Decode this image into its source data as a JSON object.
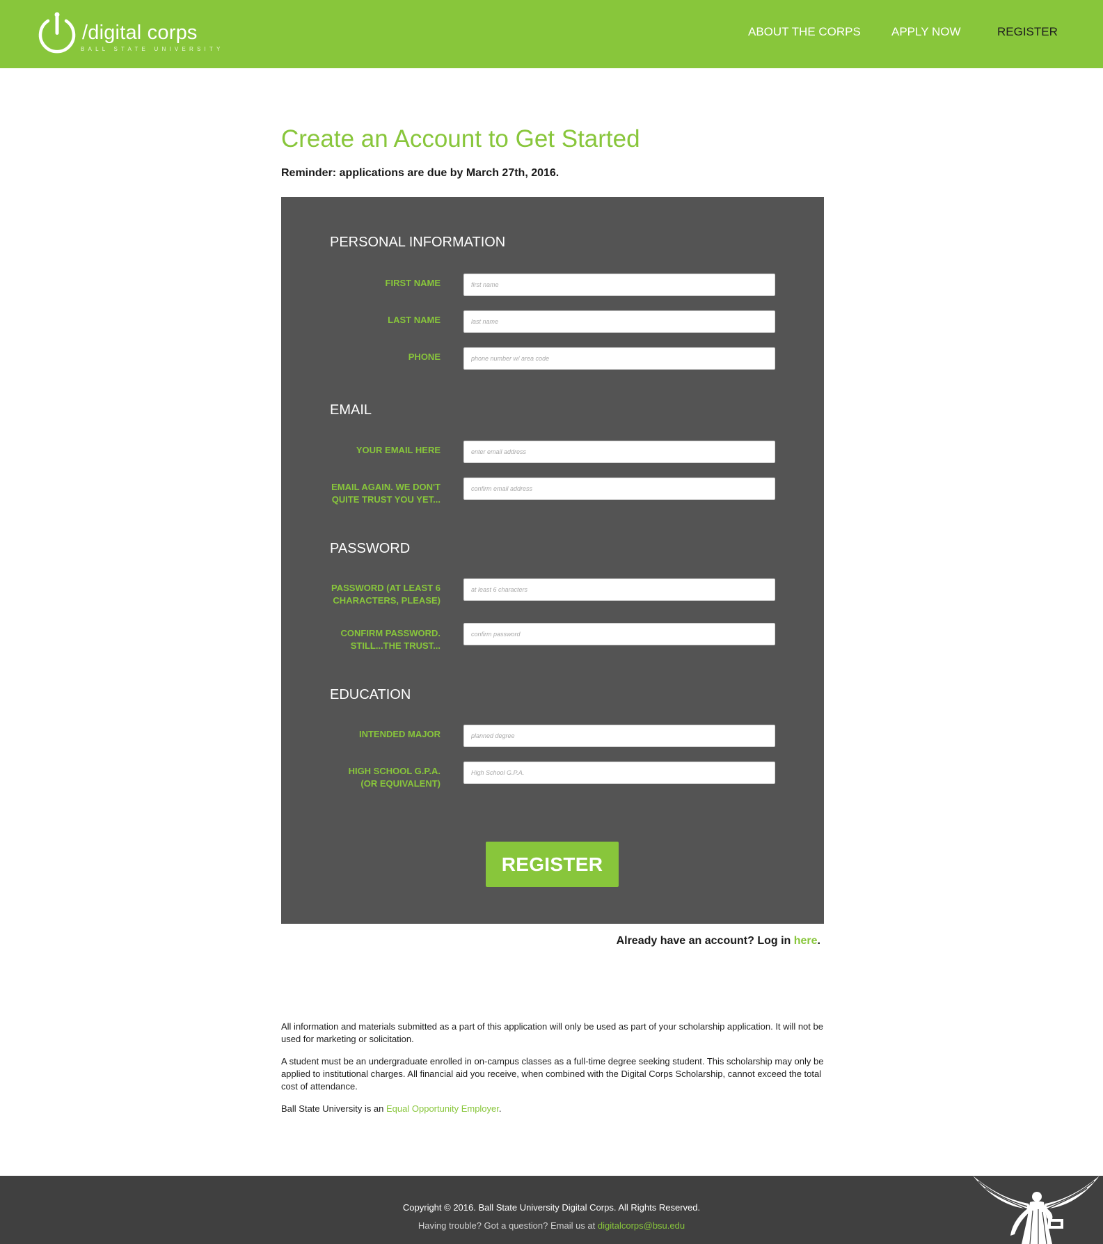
{
  "header": {
    "logo_name": "/digital corps",
    "logo_sub": "BALL STATE UNIVERSITY",
    "nav": {
      "about": "ABOUT THE CORPS",
      "apply": "APPLY NOW",
      "register": "REGISTER"
    }
  },
  "main": {
    "title": "Create an Account to Get Started",
    "reminder": "Reminder: applications are due by March 27th, 2016."
  },
  "form": {
    "sections": {
      "personal": "PERSONAL INFORMATION",
      "email": "EMAIL",
      "password": "PASSWORD",
      "education": "EDUCATION"
    },
    "fields": {
      "first_name": {
        "label": "FIRST NAME",
        "placeholder": "first name",
        "value": ""
      },
      "last_name": {
        "label": "LAST NAME",
        "placeholder": "last name",
        "value": ""
      },
      "phone": {
        "label": "PHONE",
        "placeholder": "phone number w/ area code",
        "value": ""
      },
      "email": {
        "label": "YOUR EMAIL HERE",
        "placeholder": "enter email address",
        "value": ""
      },
      "email_confirm": {
        "label_line1": "EMAIL AGAIN. WE DON'T",
        "label_line2": "QUITE TRUST YOU YET...",
        "placeholder": "confirm email address",
        "value": ""
      },
      "password": {
        "label_line1": "PASSWORD (AT LEAST 6",
        "label_line2": "CHARACTERS, PLEASE)",
        "placeholder": "at least 6 characters",
        "value": ""
      },
      "password_confirm": {
        "label_line1": "CONFIRM PASSWORD.",
        "label_line2": "STILL...THE TRUST...",
        "placeholder": "confirm password",
        "value": ""
      },
      "major": {
        "label": "INTENDED MAJOR",
        "placeholder": "planned degree",
        "value": ""
      },
      "gpa": {
        "label_line1": "HIGH SCHOOL G.P.A.",
        "label_line2": "(OR EQUIVALENT)",
        "placeholder": "High School G.P.A.",
        "value": ""
      }
    },
    "submit_label": "REGISTER"
  },
  "login": {
    "prefix": "Already have an account? Log in ",
    "link": "here",
    "suffix": "."
  },
  "disclaimer": {
    "p1": "All information and materials submitted as a part of this application will only be used as part of your scholarship application. It will not be used for marketing or solicitation.",
    "p2": "A student must be an undergraduate enrolled in on-campus classes as a full-time degree seeking student. This scholarship may only be applied to institutional charges. All financial aid you receive, when combined with the Digital Corps Scholarship, cannot exceed the total cost of attendance.",
    "p3_prefix": "Ball State University is an ",
    "p3_link": "Equal Opportunity Employer",
    "p3_suffix": "."
  },
  "footer": {
    "copyright": "Copyright © 2016. Ball State University Digital Corps. All Rights Reserved.",
    "trouble_prefix": "Having trouble? Got a question? Email us at ",
    "email": "digitalcorps@bsu.edu"
  },
  "colors": {
    "brand_green": "#88c63b",
    "panel_gray": "#545454",
    "footer_gray": "#404040"
  },
  "icons": [
    "power-logo-icon",
    "beneficence-statue-icon"
  ]
}
